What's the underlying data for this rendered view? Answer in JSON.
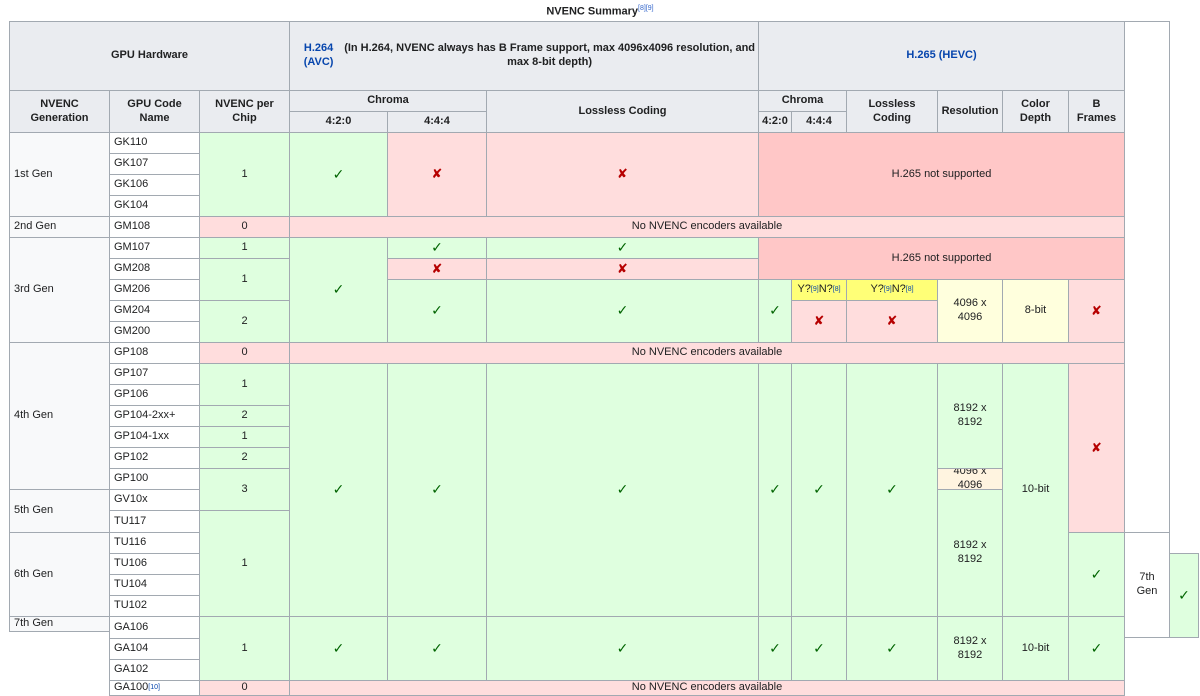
{
  "caption": {
    "text": "NVENC Summary",
    "ref1": "[8]",
    "ref2": "[9]"
  },
  "glyphs": {
    "yes": "✓",
    "no": "✘"
  },
  "headers": {
    "gpu_hardware": "GPU Hardware",
    "h264": "H.264 (AVC)",
    "h264_note": "(In H.264, NVENC always has B Frame support, max 4096x4096 resolution, and max 8-bit depth)",
    "h265": "H.265 (HEVC)",
    "generation": "NVENC Generation",
    "code_name": "GPU Code Name",
    "per_chip": "NVENC per Chip",
    "chroma": "Chroma",
    "c420": "4:2:0",
    "c444": "4:4:4",
    "lossless": "Lossless Coding",
    "resolution": "Resolution",
    "color_depth": "Color Depth",
    "b_frames": "B Frames"
  },
  "generations": {
    "g1": "1st Gen",
    "g2": "2nd Gen",
    "g3": "3rd Gen",
    "g4": "4th Gen",
    "g5": "5th Gen",
    "g6": "6th Gen",
    "g7": "7th Gen",
    "g7_extra": "7th Gen"
  },
  "gpus": [
    "GK110",
    "GK107",
    "GK106",
    "GK104",
    "GM108",
    "GM107",
    "GM208",
    "GM206",
    "GM204",
    "GM200",
    "GP108",
    "GP107",
    "GP106",
    "GP104-2xx+",
    "GP104-1xx",
    "GP102",
    "GP100",
    "GV10x",
    "TU117",
    "TU116",
    "TU106",
    "TU104",
    "TU102",
    "GA106",
    "GA104",
    "GA102",
    "GA100"
  ],
  "ga100_ref": "[10]",
  "counts": {
    "kepler": "1",
    "gm108": "0",
    "gm107": "1",
    "gm20x_small": "1",
    "gm20x_big": "2",
    "gp108": "0",
    "gp107_106": "1",
    "gp104_2xx": "2",
    "gp104_1xx": "1",
    "gp102": "2",
    "gp100_gv10x": "3",
    "turing": "1",
    "ampere": "1",
    "ga100": "0"
  },
  "texts": {
    "no_h265": "H.265 not supported",
    "no_nvenc": "No NVENC encoders available",
    "maybe_y": "Y?",
    "maybe_n": "N?",
    "ref8": "[8]",
    "ref9": "[9]",
    "res_4096": "4096 x 4096",
    "res_8192": "8192 x 8192",
    "depth_8": "8-bit",
    "depth_10": "10-bit"
  }
}
